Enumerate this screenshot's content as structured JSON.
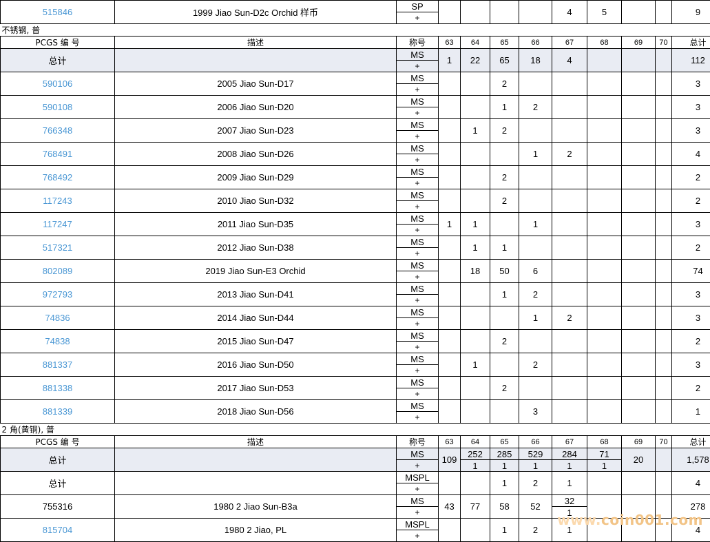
{
  "top_row": {
    "pcgs": "515846",
    "desc": "1999 Jiao Sun-D2c Orchid 样币",
    "grade_top": "SP",
    "grade_bottom": "+",
    "g67": "4",
    "g68": "5",
    "total": "9"
  },
  "section1": {
    "title": "不锈钢, 普",
    "headers": {
      "pcgs": "PCGS 编 号",
      "desc": "描述",
      "grade": "称号",
      "g63": "63",
      "g64": "64",
      "g65": "65",
      "g66": "66",
      "g67": "67",
      "g68": "68",
      "g69": "69",
      "g70": "70",
      "total": "总计"
    },
    "total_row": {
      "label": "总计",
      "grade_top": "MS",
      "grade_bottom": "+",
      "g63": "1",
      "g64": "22",
      "g65": "65",
      "g66": "18",
      "g67": "4",
      "total": "112"
    },
    "rows": [
      {
        "pcgs": "590106",
        "desc": "2005 Jiao Sun-D17",
        "grade_top": "MS",
        "grade_bottom": "+",
        "g65": "2",
        "total": "3"
      },
      {
        "pcgs": "590108",
        "desc": "2006 Jiao Sun-D20",
        "grade_top": "MS",
        "grade_bottom": "+",
        "g65": "1",
        "g66": "2",
        "total": "3"
      },
      {
        "pcgs": "766348",
        "desc": "2007 Jiao Sun-D23",
        "grade_top": "MS",
        "grade_bottom": "+",
        "g64": "1",
        "g65": "2",
        "total": "3"
      },
      {
        "pcgs": "768491",
        "desc": "2008 Jiao Sun-D26",
        "grade_top": "MS",
        "grade_bottom": "+",
        "g66": "1",
        "g67": "2",
        "total": "4"
      },
      {
        "pcgs": "768492",
        "desc": "2009 Jiao Sun-D29",
        "grade_top": "MS",
        "grade_bottom": "+",
        "g65": "2",
        "total": "2"
      },
      {
        "pcgs": "117243",
        "desc": "2010 Jiao Sun-D32",
        "grade_top": "MS",
        "grade_bottom": "+",
        "g65": "2",
        "total": "2"
      },
      {
        "pcgs": "117247",
        "desc": "2011 Jiao Sun-D35",
        "grade_top": "MS",
        "grade_bottom": "+",
        "g63": "1",
        "g64": "1",
        "g66": "1",
        "total": "3"
      },
      {
        "pcgs": "517321",
        "desc": "2012 Jiao Sun-D38",
        "grade_top": "MS",
        "grade_bottom": "+",
        "g64": "1",
        "g65": "1",
        "total": "2"
      },
      {
        "pcgs": "802089",
        "desc": "2019 Jiao Sun-E3 Orchid",
        "grade_top": "MS",
        "grade_bottom": "+",
        "g64": "18",
        "g65": "50",
        "g66": "6",
        "total": "74"
      },
      {
        "pcgs": "972793",
        "desc": "2013 Jiao Sun-D41",
        "grade_top": "MS",
        "grade_bottom": "+",
        "g65": "1",
        "g66": "2",
        "total": "3"
      },
      {
        "pcgs": "74836",
        "desc": "2014 Jiao Sun-D44",
        "grade_top": "MS",
        "grade_bottom": "+",
        "g66": "1",
        "g67": "2",
        "total": "3"
      },
      {
        "pcgs": "74838",
        "desc": "2015 Jiao Sun-D47",
        "grade_top": "MS",
        "grade_bottom": "+",
        "g65": "2",
        "total": "2"
      },
      {
        "pcgs": "881337",
        "desc": "2016 Jiao Sun-D50",
        "grade_top": "MS",
        "grade_bottom": "+",
        "g64": "1",
        "g66": "2",
        "total": "3"
      },
      {
        "pcgs": "881338",
        "desc": "2017 Jiao Sun-D53",
        "grade_top": "MS",
        "grade_bottom": "+",
        "g65": "2",
        "total": "2"
      },
      {
        "pcgs": "881339",
        "desc": "2018 Jiao Sun-D56",
        "grade_top": "MS",
        "grade_bottom": "+",
        "g66": "3",
        "total": "1"
      }
    ]
  },
  "section2": {
    "title": "2 角(黄铜), 普",
    "headers": {
      "pcgs": "PCGS 编 号",
      "desc": "描述",
      "grade": "称号",
      "g63": "63",
      "g64": "64",
      "g65": "65",
      "g66": "66",
      "g67": "67",
      "g68": "68",
      "g69": "69",
      "g70": "70",
      "total": "总计"
    },
    "total_ms": {
      "label": "总计",
      "grade_top": "MS",
      "grade_bottom": "+",
      "g63": "109",
      "g64_top": "252",
      "g64_bottom": "1",
      "g65_top": "285",
      "g65_bottom": "1",
      "g66_top": "529",
      "g66_bottom": "1",
      "g67_top": "284",
      "g67_bottom": "1",
      "g68_top": "71",
      "g68_bottom": "1",
      "g69": "20",
      "total": "1,578"
    },
    "total_mspl": {
      "label": "总计",
      "grade_top": "MSPL",
      "grade_bottom": "+",
      "g65": "1",
      "g66": "2",
      "g67": "1",
      "total": "4"
    },
    "row_755316": {
      "pcgs": "755316",
      "desc": "1980 2 Jiao Sun-B3a",
      "grade_top": "MS",
      "grade_bottom": "+",
      "g63": "43",
      "g64": "77",
      "g65": "58",
      "g66": "52",
      "g67_top": "32",
      "g67_bottom": "1",
      "total": "278"
    },
    "row_815704": {
      "pcgs": "815704",
      "desc": "1980 2 Jiao, PL",
      "grade_top": "MSPL",
      "grade_bottom": "+",
      "g65": "1",
      "g66": "2",
      "g67": "1",
      "total": "4"
    }
  },
  "watermark": {
    "text_a": "www.",
    "text_b": "coin001.com"
  },
  "colors": {
    "link": "#4a97d4",
    "total_bg": "#e9ecf3",
    "watermark": "#f2c487"
  }
}
